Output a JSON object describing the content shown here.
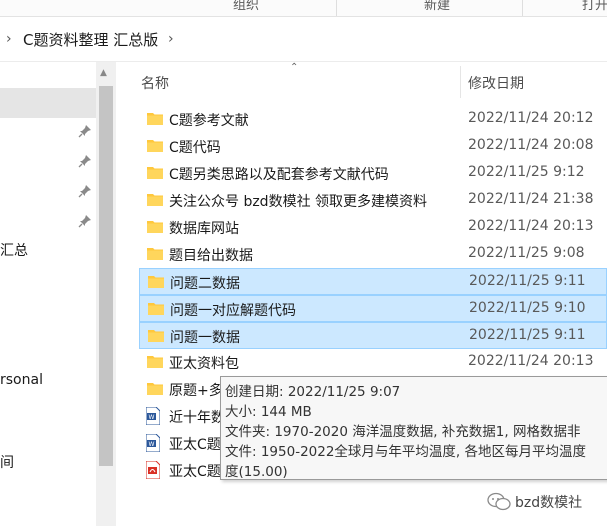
{
  "ribbon": {
    "groups": [
      "组织",
      "新建",
      "打开"
    ]
  },
  "address_bar": {
    "path": "C题资料整理 汇总版"
  },
  "nav_pane": {
    "labels": [
      "汇总",
      "rsonal",
      "间"
    ]
  },
  "columns": {
    "name": "名称",
    "date_modified": "修改日期"
  },
  "files": [
    {
      "name": "C题参考文献",
      "date": "2022/11/24 20:12",
      "type": "folder",
      "selected": false
    },
    {
      "name": "C题代码",
      "date": "2022/11/24 20:08",
      "type": "folder",
      "selected": false
    },
    {
      "name": "C题另类思路以及配套参考文献代码",
      "date": "2022/11/25 9:12",
      "type": "folder",
      "selected": false
    },
    {
      "name": "关注公众号 bzd数模社 领取更多建模资料",
      "date": "2022/11/24 21:38",
      "type": "folder",
      "selected": false
    },
    {
      "name": "数据库网站",
      "date": "2022/11/24 20:13",
      "type": "folder",
      "selected": false
    },
    {
      "name": "题目给出数据",
      "date": "2022/11/25 9:08",
      "type": "folder",
      "selected": false
    },
    {
      "name": "问题二数据",
      "date": "2022/11/25 9:11",
      "type": "folder",
      "selected": true
    },
    {
      "name": "问题一对应解题代码",
      "date": "2022/11/25 9:10",
      "type": "folder",
      "selected": true
    },
    {
      "name": "问题一数据",
      "date": "2022/11/25 9:11",
      "type": "folder",
      "selected": true
    },
    {
      "name": "亚太资料包",
      "date": "2022/11/24 20:13",
      "type": "folder",
      "selected": false
    },
    {
      "name": "原题+多",
      "date": "",
      "type": "folder",
      "selected": false
    },
    {
      "name": "近十年数",
      "date": "",
      "type": "word",
      "selected": false
    },
    {
      "name": "亚太C题",
      "date": "",
      "type": "word",
      "selected": false
    },
    {
      "name": "亚太C题",
      "date": "",
      "type": "pdf",
      "selected": false
    }
  ],
  "tooltip": {
    "lines": [
      "创建日期: 2022/11/25 9:07",
      "大小: 144 MB",
      "文件夹: 1970-2020 海洋温度数据, 补充数据1, 网格数据非",
      "文件: 1950-2022全球月与年平均温度, 各地区每月平均温度",
      "度(15.00)"
    ]
  },
  "watermark": {
    "text": "bzd数模社"
  },
  "colors": {
    "folder": "#ffc83d",
    "selection": "#cce8ff",
    "selection_border": "#99d1ff",
    "word": "#2b579a",
    "pdf": "#d93025"
  }
}
